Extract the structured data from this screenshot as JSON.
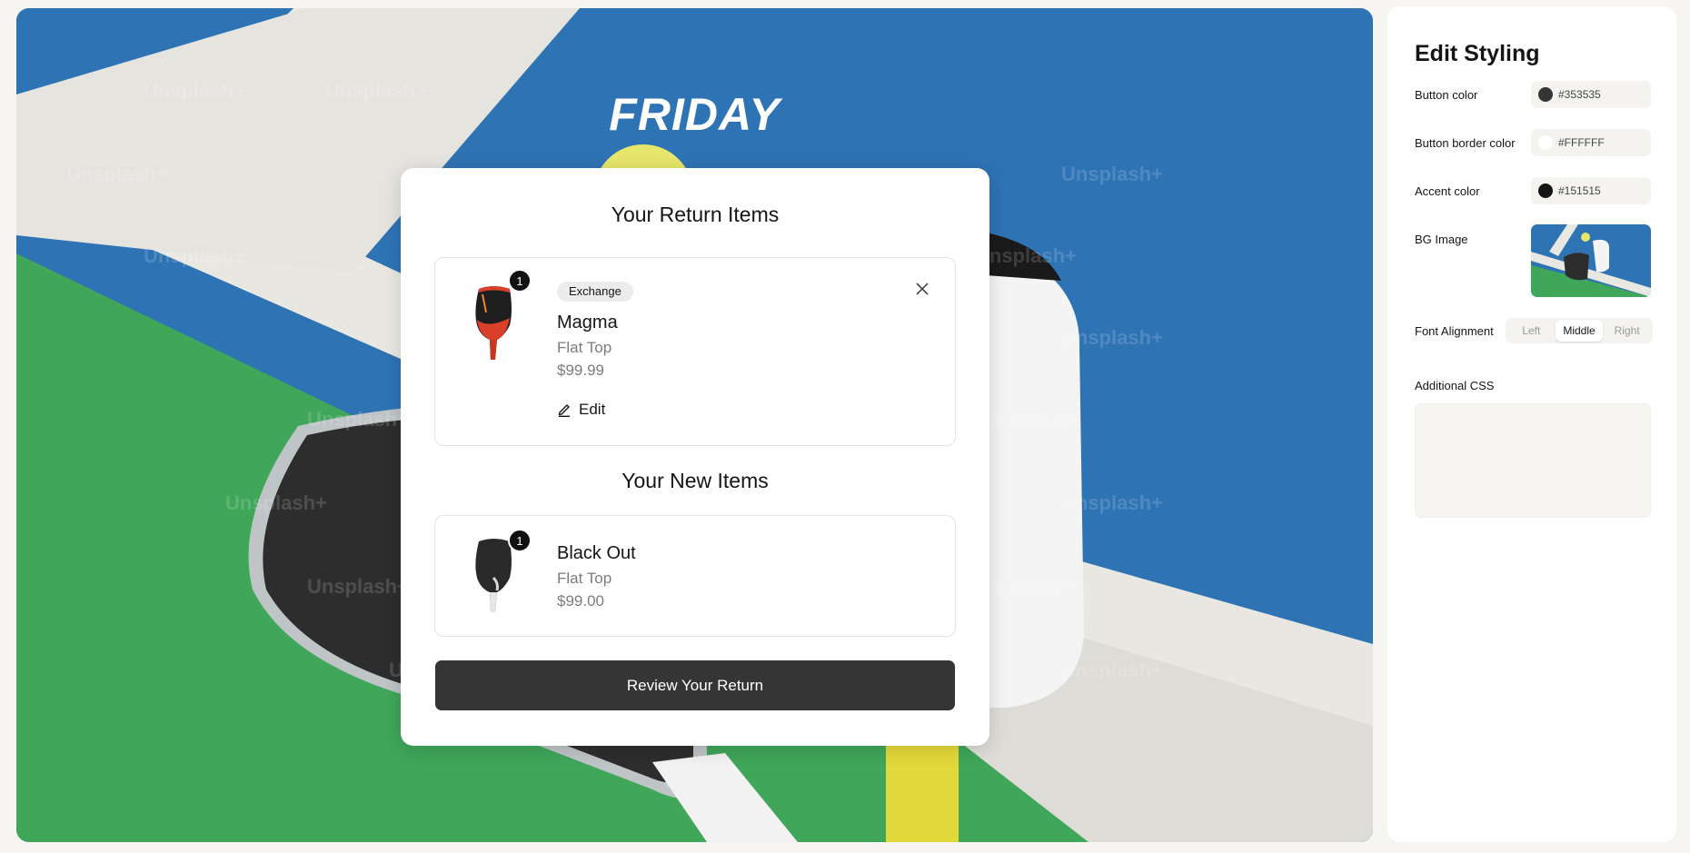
{
  "preview": {
    "brand": "FRIDAY",
    "watermark": "Unsplash+",
    "return_section": {
      "title": "Your Return Items",
      "item": {
        "qty": "1",
        "tag": "Exchange",
        "name": "Magma",
        "variant": "Flat Top",
        "price": "$99.99",
        "edit_label": "Edit"
      }
    },
    "new_section": {
      "title": "Your New Items",
      "item": {
        "qty": "1",
        "name": "Black Out",
        "variant": "Flat Top",
        "price": "$99.00"
      }
    },
    "review_button": "Review Your Return"
  },
  "panel": {
    "title": "Edit Styling",
    "button_color": {
      "label": "Button color",
      "value": "#353535"
    },
    "button_border_color": {
      "label": "Button border color",
      "value": "#FFFFFF"
    },
    "accent_color": {
      "label": "Accent color",
      "value": "#151515"
    },
    "bg_image": {
      "label": "BG Image"
    },
    "font_alignment": {
      "label": "Font Alignment",
      "options": [
        "Left",
        "Middle",
        "Right"
      ],
      "selected": "Middle"
    },
    "additional_css": {
      "label": "Additional CSS",
      "value": ""
    }
  }
}
